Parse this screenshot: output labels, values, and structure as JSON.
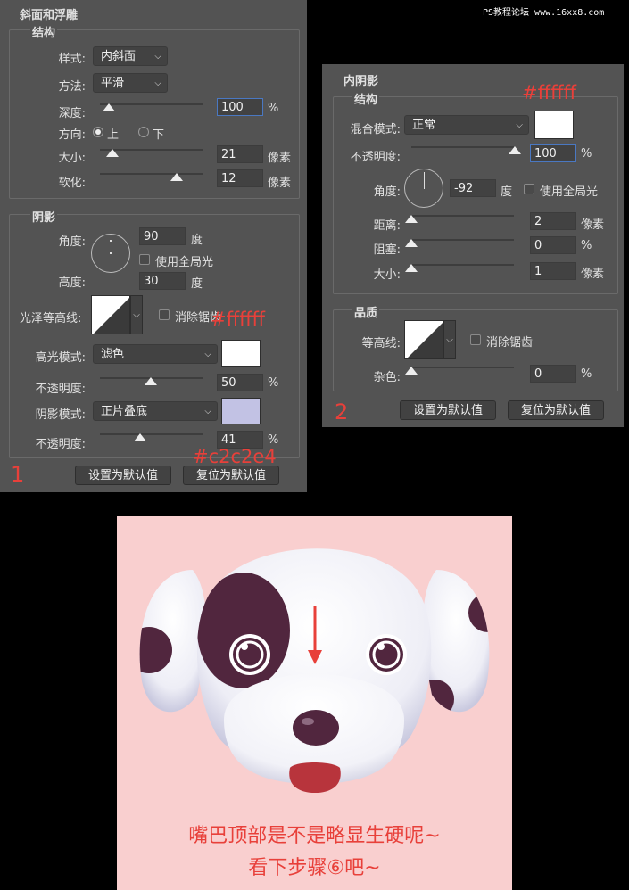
{
  "watermark": "PS教程论坛 www.16xx8.com",
  "panel1": {
    "header": "斜面和浮雕",
    "structure_title": "结构",
    "style_label": "样式:",
    "style_value": "内斜面",
    "method_label": "方法:",
    "method_value": "平滑",
    "depth_label": "深度:",
    "depth_value": "100",
    "depth_unit": "%",
    "direction_label": "方向:",
    "direction_up": "上",
    "direction_down": "下",
    "size_label": "大小:",
    "size_value": "21",
    "size_unit": "像素",
    "soften_label": "软化:",
    "soften_value": "12",
    "soften_unit": "像素",
    "shading_title": "阴影",
    "angle_label": "角度:",
    "angle_value": "90",
    "angle_unit": "度",
    "global_light": "使用全局光",
    "altitude_label": "高度:",
    "altitude_value": "30",
    "altitude_unit": "度",
    "gloss_label": "光泽等高线:",
    "anti_alias": "消除锯齿",
    "highlight_mode_label": "高光模式:",
    "highlight_mode_value": "滤色",
    "highlight_opacity_label": "不透明度:",
    "highlight_opacity_value": "50",
    "highlight_opacity_unit": "%",
    "shadow_mode_label": "阴影模式:",
    "shadow_mode_value": "正片叠底",
    "shadow_opacity_label": "不透明度:",
    "shadow_opacity_value": "41",
    "shadow_opacity_unit": "%",
    "reset_default": "设置为默认值",
    "restore_default": "复位为默认值",
    "highlight_color": "#ffffff",
    "shadow_color": "#c2c2e4",
    "annotation_highlight": "#ffffff",
    "annotation_shadow": "#c2c2e4",
    "number": "1"
  },
  "panel2": {
    "header": "内阴影",
    "structure_title": "结构",
    "blend_label": "混合模式:",
    "blend_value": "正常",
    "opacity_label": "不透明度:",
    "opacity_value": "100",
    "opacity_unit": "%",
    "angle_label": "角度:",
    "angle_value": "-92",
    "angle_unit": "度",
    "global_light": "使用全局光",
    "distance_label": "距离:",
    "distance_value": "2",
    "distance_unit": "像素",
    "choke_label": "阻塞:",
    "choke_value": "0",
    "choke_unit": "%",
    "size_label": "大小:",
    "size_value": "1",
    "size_unit": "像素",
    "quality_title": "品质",
    "contour_label": "等高线:",
    "anti_alias": "消除锯齿",
    "noise_label": "杂色:",
    "noise_value": "0",
    "noise_unit": "%",
    "reset_default": "设置为默认值",
    "restore_default": "复位为默认值",
    "color": "#ffffff",
    "annotation_color": "#ffffff",
    "number": "2"
  },
  "illustration": {
    "background": "#f9cfcf",
    "caption_line1": "嘴巴顶部是不是略显生硬呢~",
    "caption_line2": "看下步骤⑥吧~"
  }
}
